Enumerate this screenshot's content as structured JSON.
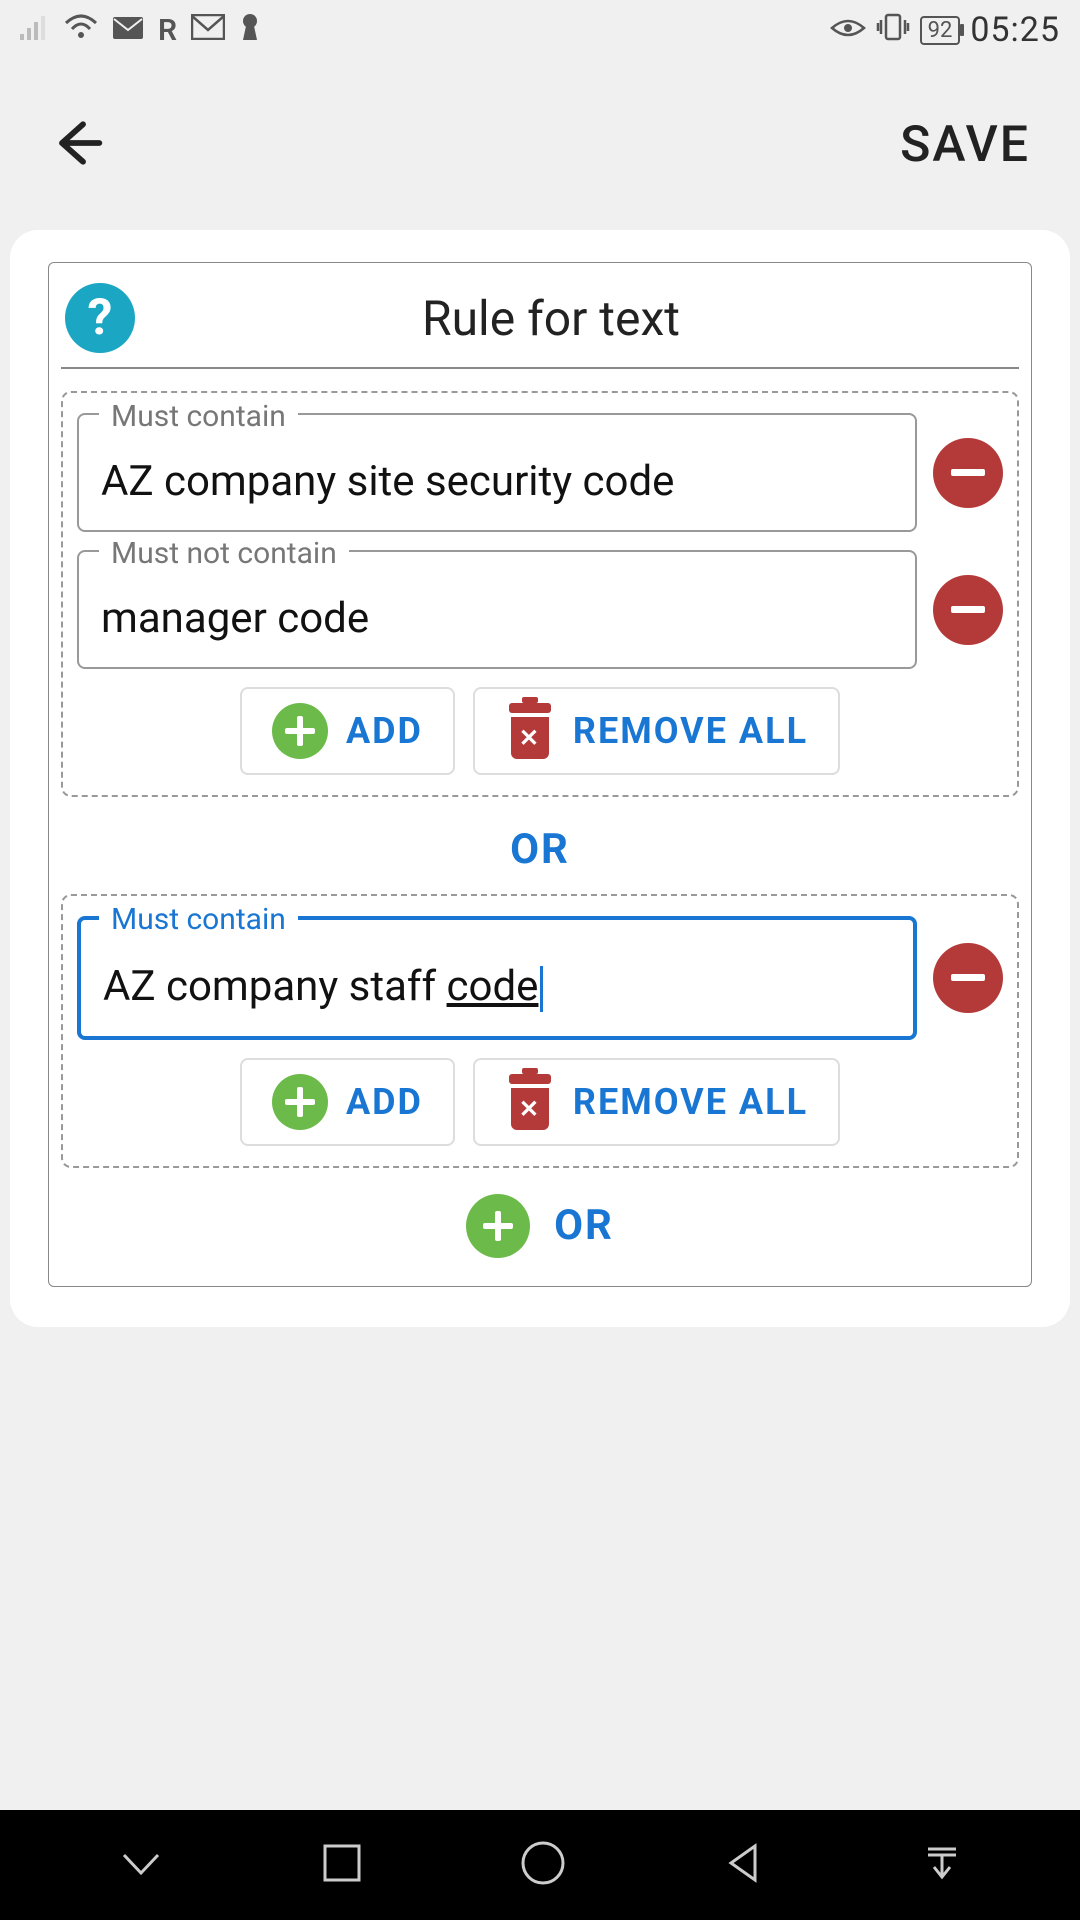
{
  "status_bar": {
    "carrier_letter": "R",
    "battery_percent": "92",
    "time": "05:25"
  },
  "app_bar": {
    "save_label": "SAVE"
  },
  "panel": {
    "title": "Rule for text"
  },
  "groups": [
    {
      "conditions": [
        {
          "label": "Must contain",
          "value": "AZ company site security code",
          "focused": false
        },
        {
          "label": "Must not contain",
          "value": "manager code",
          "focused": false
        }
      ]
    },
    {
      "conditions": [
        {
          "label": "Must contain",
          "value_plain": "AZ company staff ",
          "value_suffix": "code",
          "focused": true
        }
      ]
    }
  ],
  "buttons": {
    "add": "ADD",
    "remove_all": "REMOVE ALL",
    "or": "OR"
  },
  "colors": {
    "primary": "#1976d2",
    "help": "#1ba6c4",
    "danger": "#b43a3a",
    "success": "#6cbb4a"
  }
}
